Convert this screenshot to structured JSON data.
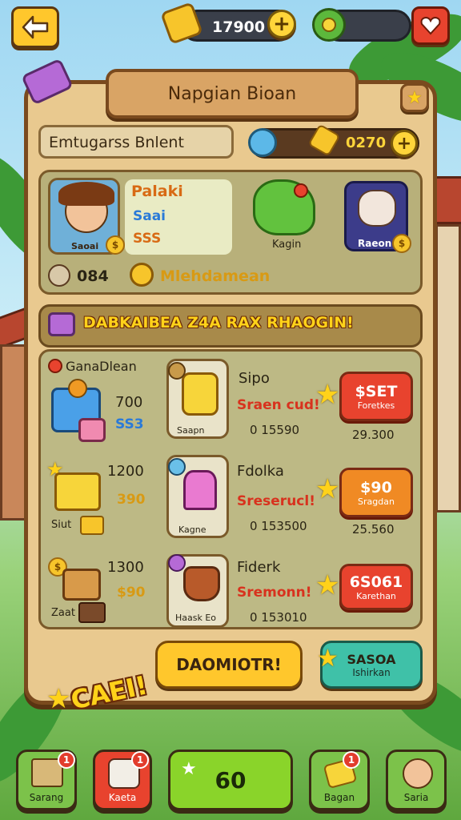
{
  "topbar": {
    "coins": "17900",
    "plus": "+",
    "back_icon": "back-arrow-icon",
    "gift_icon": "heart-gift-icon"
  },
  "panel": {
    "title": "Napgian Bioan",
    "player_name": "Emtugarss Bnlent",
    "currency_value": "0270",
    "plus": "+"
  },
  "profile": {
    "avatar_label": "Saoai",
    "name": "Palaki",
    "stat1": "Saai",
    "stat2": "SSS",
    "pet1_label": "Kagin",
    "pet2_label": "Raeon",
    "resource1": "084",
    "resource2": "Mlehdamean"
  },
  "shop": {
    "banner": "DABKAIBEA Z4A RAX RHAOGIN!",
    "section_title": "GanaDlean",
    "rows": [
      {
        "left_value": "700",
        "left_sub": "SS3",
        "left_label": "",
        "item_label": "Saapn",
        "name": "Sipo",
        "subtitle": "Sraen cud!",
        "qty": "0 15590",
        "price": "$SET",
        "price_sub": "Foretkes",
        "total": "29.300"
      },
      {
        "left_value": "1200",
        "left_sub": "390",
        "left_label": "Siut",
        "item_label": "Kagne",
        "name": "Fdolka",
        "subtitle": "Sreserucl!",
        "qty": "0 153500",
        "price": "$90",
        "price_sub": "Sragdan",
        "total": "25.560"
      },
      {
        "left_value": "1300",
        "left_sub": "$90",
        "left_label": "Zaat",
        "item_label": "Haask Eo",
        "name": "Fiderk",
        "subtitle": "Sremonn!",
        "qty": "0 153010",
        "price": "6S061",
        "price_sub": "Karethan",
        "total": ""
      }
    ],
    "primary_button": "DAOMIOTR!",
    "secondary_button_line1": "SASOA",
    "secondary_button_line2": "Ishirkan",
    "sticker": "CAEI!"
  },
  "nav": [
    {
      "label": "Sarang",
      "badge": "1",
      "icon": "box-icon"
    },
    {
      "label": "Kaeta",
      "badge": "1",
      "icon": "face-icon"
    },
    {
      "label": "60",
      "badge": "",
      "icon": "star-icon"
    },
    {
      "label": "Bagan",
      "badge": "1",
      "icon": "gem-icon"
    },
    {
      "label": "Saria",
      "badge": "",
      "icon": "avatar-icon"
    }
  ],
  "colors": {
    "panel": "#e9c98f",
    "wood": "#7a4a1e",
    "red_btn": "#e8432e",
    "orange_btn": "#f08a24",
    "green_btn": "#8ad42a",
    "teal_btn": "#3fc1a8",
    "yellow_btn": "#ffc72c"
  }
}
